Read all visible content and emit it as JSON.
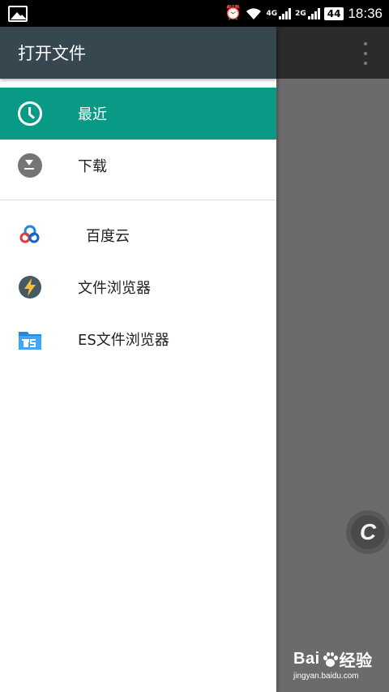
{
  "status_bar": {
    "network_type": "4G",
    "network_type2": "2G",
    "battery": "44",
    "time": "18:36"
  },
  "drawer": {
    "title": "打开文件",
    "roots": [
      {
        "label": "最近",
        "icon": "clock-icon",
        "selected": true
      },
      {
        "label": "下载",
        "icon": "download-icon",
        "selected": false
      }
    ],
    "apps": [
      {
        "label": "百度云",
        "icon": "baidu-cloud-icon"
      },
      {
        "label": "文件浏览器",
        "icon": "file-browser-bolt-icon"
      },
      {
        "label": "ES文件浏览器",
        "icon": "es-file-explorer-icon"
      }
    ]
  },
  "floating_button": {
    "label": "C"
  },
  "watermark": {
    "brand_a": "Bai",
    "brand_b": "经验",
    "url": "jingyan.baidu.com"
  },
  "colors": {
    "accent": "#089a85",
    "header": "#37474f",
    "scrim": "#6b6b6b"
  }
}
